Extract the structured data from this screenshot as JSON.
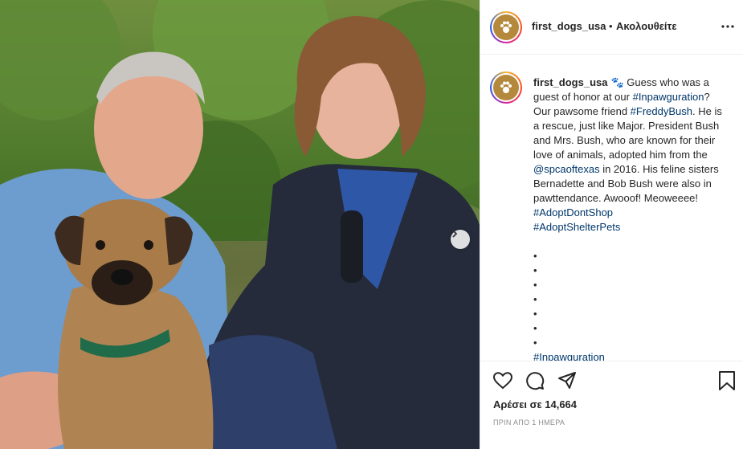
{
  "post": {
    "username": "first_dogs_usa",
    "separator": "•",
    "follow_label": "Ακολουθείτε",
    "more_icon": "more-options-icon"
  },
  "caption": {
    "username": "first_dogs_usa",
    "emoji": "🐾",
    "line1": " Guess who was a guest of honor at our ",
    "hashtag1": "#Inpawguration",
    "line2": "? Our pawsome friend ",
    "hashtag2": "#FreddyBush",
    "line3": ". He is a rescue, just like Major. President Bush and Mrs. Bush, who are known for their love of animals, adopted him from the ",
    "mention": "@spcaoftexas",
    "line4": " in 2016. His feline sisters Bernadette and Bob Bush were also in pawttendance. Awooof! Meoweeee! ",
    "hashtag3": "#AdoptDontShop",
    "hashtag4": "#AdoptShelterPets",
    "dot": "•",
    "trailing_hashtag": "#Inpawguration"
  },
  "engagement": {
    "likes_text": "Αρέσει σε 14,664",
    "timestamp": "ΠΡΙΝ ΑΠΟ 1 ΗΜΕΡΑ"
  },
  "icons": [
    "heart-icon",
    "comment-icon",
    "share-icon",
    "bookmark-icon",
    "next-arrow-icon",
    "paw-icon"
  ],
  "colors": {
    "link": "#00376b",
    "text": "#262626",
    "muted": "#8e8e8e",
    "divider": "#efefef"
  }
}
